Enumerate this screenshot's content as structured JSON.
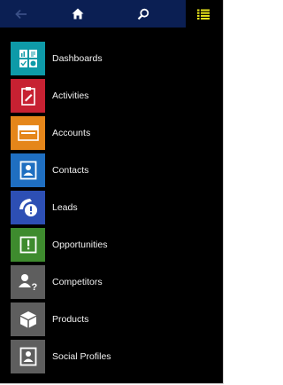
{
  "nav": {
    "back_icon": "arrow-left-icon",
    "home_icon": "home-icon",
    "search_icon": "search-icon",
    "menu_icon": "list-menu-icon",
    "band_color": "#0b1f53",
    "menu_accent": "#e8e51b"
  },
  "menu": {
    "items": [
      {
        "label": "Dashboards",
        "icon": "dashboard-icon",
        "color": "#0e9aa8"
      },
      {
        "label": "Activities",
        "icon": "clipboard-icon",
        "color": "#c72132"
      },
      {
        "label": "Accounts",
        "icon": "folder-icon",
        "color": "#e5861a"
      },
      {
        "label": "Contacts",
        "icon": "contact-card-icon",
        "color": "#1f6fc1"
      },
      {
        "label": "Leads",
        "icon": "lead-phone-icon",
        "color": "#2d4fb4"
      },
      {
        "label": "Opportunities",
        "icon": "opportunity-icon",
        "color": "#3e8b2e"
      },
      {
        "label": "Competitors",
        "icon": "competitor-icon",
        "color": "#5e5e5e"
      },
      {
        "label": "Products",
        "icon": "product-box-icon",
        "color": "#5e5e5e"
      },
      {
        "label": "Social Profiles",
        "icon": "social-profile-icon",
        "color": "#5e5e5e"
      }
    ]
  }
}
